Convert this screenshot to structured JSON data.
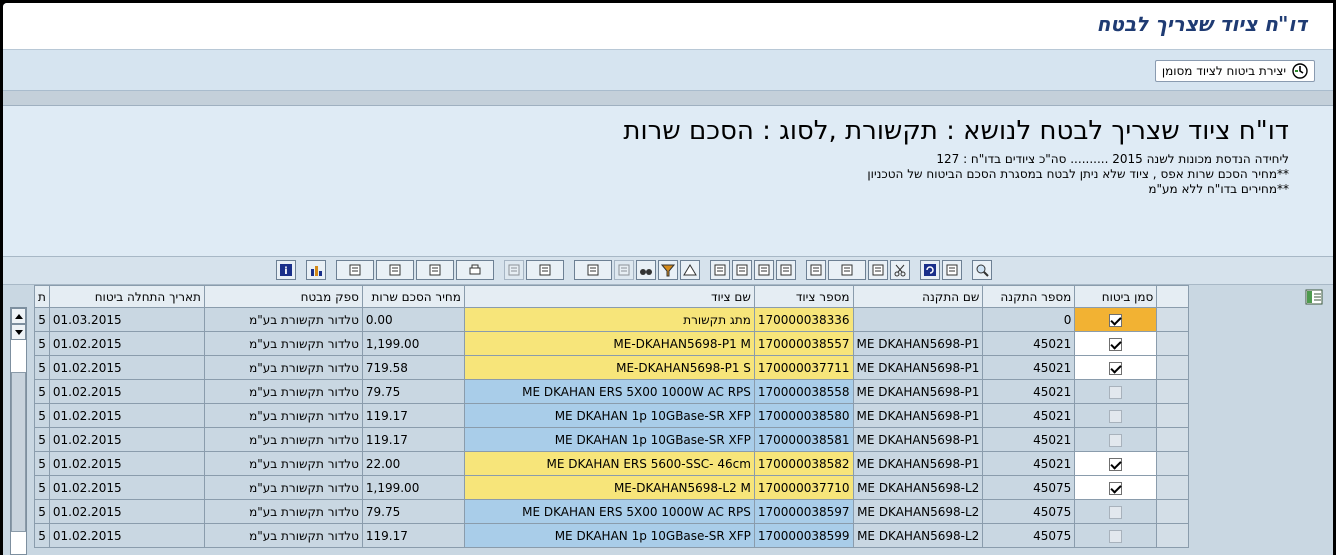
{
  "window": {
    "title": "דו\"ח ציוד שצריך לבטח"
  },
  "action": {
    "create_label": "יצירת ביטוח לציוד מסומן"
  },
  "header": {
    "title": "דו\"ח ציוד שצריך לבטח לנושא : תקשורת ,לסוג : הסכם שרות",
    "line1": "ליחידה הנדסת מכונות לשנה 2015 .......... סה\"כ ציודים בדו\"ח : 127",
    "line2": "**מחיר הסכם שרות אפס , ציוד שלא ניתן לבטח במסגרת הסכם הביטוח של הטכניון",
    "line3": "**מחירים בדו\"ח ללא מע\"מ"
  },
  "toolbar": {
    "icons": [
      "info-icon",
      "chart-icon",
      "layout-icon",
      "export-icon",
      "copy-icon",
      "print-icon",
      "sum-disabled-icon",
      "sum-icon",
      "filter-icon",
      "find-disabled-icon",
      "binoculars-icon",
      "funnel-icon",
      "triangle-icon",
      "doc-icon",
      "doc-red-icon",
      "doc-green-icon",
      "blank-doc-icon",
      "select-icon",
      "paste-icon",
      "page-icon",
      "scissors-icon",
      "refresh-icon",
      "collapse-icon",
      "zoom-icon"
    ]
  },
  "table": {
    "columns": [
      "סמן ביטוח",
      "מספר התקנה",
      "שם התקנה",
      "מספר ציוד",
      "שם ציוד",
      "מחיר הסכם שרות",
      "ספק מבטח",
      "תאריך התחלה ביטוח",
      "ת"
    ],
    "rows": [
      {
        "checked": true,
        "install_no": "0",
        "install_name": "",
        "equip_no": "170000038336",
        "equip_name": "מתג תקשורת",
        "price": "0.00",
        "supplier": "טלדור תקשורת בע\"מ",
        "date": "01.03.2015",
        "t": "5",
        "color": "yel",
        "sel": true
      },
      {
        "checked": true,
        "install_no": "45021",
        "install_name": "ME DKAHAN5698-P1",
        "equip_no": "170000038557",
        "equip_name": "ME-DKAHAN5698-P1 M",
        "price": "1,199.00",
        "supplier": "טלדור תקשורת בע\"מ",
        "date": "01.02.2015",
        "t": "5",
        "color": "yel"
      },
      {
        "checked": true,
        "install_no": "45021",
        "install_name": "ME DKAHAN5698-P1",
        "equip_no": "170000037711",
        "equip_name": "ME-DKAHAN5698-P1 S",
        "price": "719.58",
        "supplier": "טלדור תקשורת בע\"מ",
        "date": "01.02.2015",
        "t": "5",
        "color": "yel"
      },
      {
        "checked": false,
        "install_no": "45021",
        "install_name": "ME DKAHAN5698-P1",
        "equip_no": "170000038558",
        "equip_name": "ME DKAHAN ERS 5X00 1000W AC RPS",
        "price": "79.75",
        "supplier": "טלדור תקשורת בע\"מ",
        "date": "01.02.2015",
        "t": "5",
        "color": "blu"
      },
      {
        "checked": false,
        "install_no": "45021",
        "install_name": "ME DKAHAN5698-P1",
        "equip_no": "170000038580",
        "equip_name": "ME DKAHAN 1p 10GBase-SR XFP",
        "price": "119.17",
        "supplier": "טלדור תקשורת בע\"מ",
        "date": "01.02.2015",
        "t": "5",
        "color": "blu"
      },
      {
        "checked": false,
        "install_no": "45021",
        "install_name": "ME DKAHAN5698-P1",
        "equip_no": "170000038581",
        "equip_name": "ME DKAHAN 1p 10GBase-SR XFP",
        "price": "119.17",
        "supplier": "טלדור תקשורת בע\"מ",
        "date": "01.02.2015",
        "t": "5",
        "color": "blu"
      },
      {
        "checked": true,
        "install_no": "45021",
        "install_name": "ME DKAHAN5698-P1",
        "equip_no": "170000038582",
        "equip_name": "ME DKAHAN ERS 5600-SSC- 46cm",
        "price": "22.00",
        "supplier": "טלדור תקשורת בע\"מ",
        "date": "01.02.2015",
        "t": "5",
        "color": "yel"
      },
      {
        "checked": true,
        "install_no": "45075",
        "install_name": "ME DKAHAN5698-L2",
        "equip_no": "170000037710",
        "equip_name": "ME-DKAHAN5698-L2 M",
        "price": "1,199.00",
        "supplier": "טלדור תקשורת בע\"מ",
        "date": "01.02.2015",
        "t": "5",
        "color": "yel"
      },
      {
        "checked": false,
        "install_no": "45075",
        "install_name": "ME DKAHAN5698-L2",
        "equip_no": "170000038597",
        "equip_name": "ME DKAHAN ERS 5X00 1000W AC RPS",
        "price": "79.75",
        "supplier": "טלדור תקשורת בע\"מ",
        "date": "01.02.2015",
        "t": "5",
        "color": "blu"
      },
      {
        "checked": false,
        "install_no": "45075",
        "install_name": "ME DKAHAN5698-L2",
        "equip_no": "170000038599",
        "equip_name": "ME DKAHAN 1p 10GBase-SR XFP",
        "price": "119.17",
        "supplier": "טלדור תקשורת בע\"מ",
        "date": "01.02.2015",
        "t": "5",
        "color": "blu"
      }
    ]
  }
}
